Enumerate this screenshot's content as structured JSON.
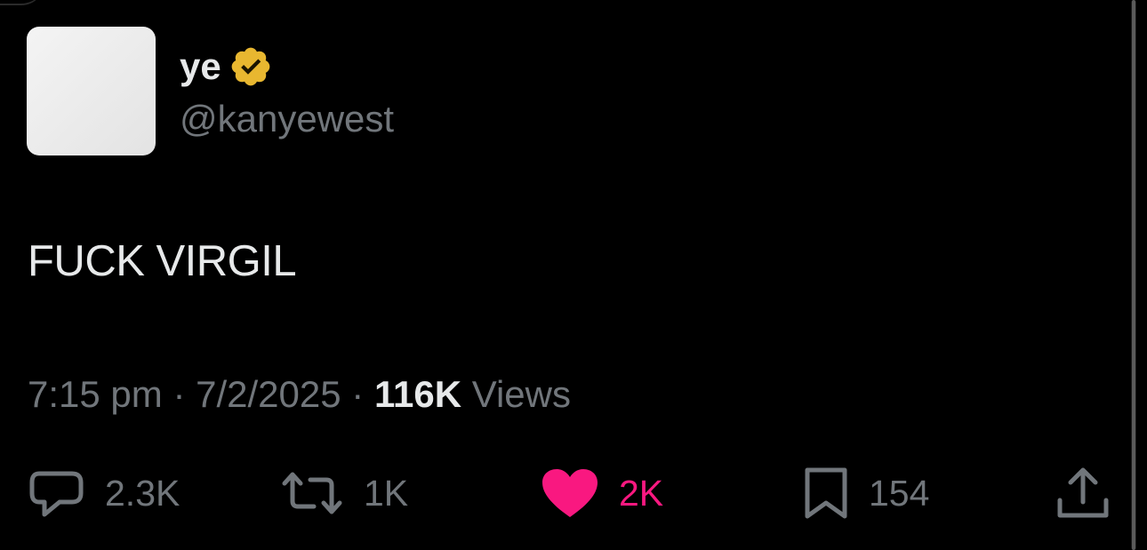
{
  "tweet": {
    "author": {
      "display_name": "ye",
      "handle": "@kanyewest",
      "verified": true,
      "verified_icon": "verified-badge-icon",
      "verified_color": "#e8b730"
    },
    "text": "FUCK VIRGIL",
    "meta": {
      "time": "7:15 pm",
      "separator": "·",
      "date": "7/2/2025",
      "views_count": "116K",
      "views_label": "Views"
    },
    "actions": {
      "reply": {
        "icon": "reply-icon",
        "count": "2.3K"
      },
      "repost": {
        "icon": "repost-icon",
        "count": "1K"
      },
      "like": {
        "icon": "heart-icon",
        "count": "2K",
        "liked": true,
        "color": "#f91880"
      },
      "bookmark": {
        "icon": "bookmark-icon",
        "count": "154"
      },
      "share": {
        "icon": "share-icon"
      }
    }
  },
  "theme": {
    "background": "#000000",
    "primary_text": "#e7e9ea",
    "secondary_text": "#71767b"
  }
}
